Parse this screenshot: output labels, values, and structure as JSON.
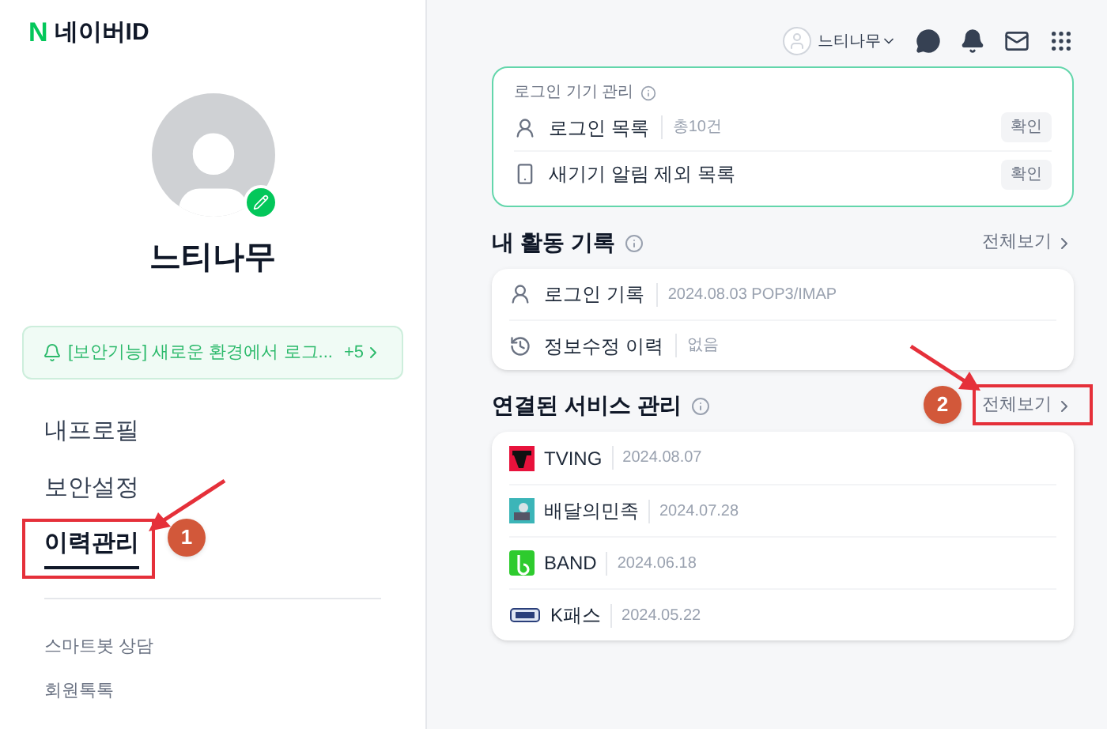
{
  "brand": {
    "mark": "N",
    "name": "네이버ID"
  },
  "profile": {
    "name": "느티나무",
    "editable": true
  },
  "notice": {
    "text": "[보안기능] 새로운 환경에서 로그...",
    "count": "+5"
  },
  "nav": [
    {
      "label": "내프로필",
      "selected": false
    },
    {
      "label": "보안설정",
      "selected": false
    },
    {
      "label": "이력관리",
      "selected": true
    }
  ],
  "footer_links": [
    "스마트봇 상담",
    "회원톡톡"
  ],
  "header": {
    "user": "느티나무"
  },
  "devices": {
    "title": "로그인 기기 관리",
    "rows": [
      {
        "kind": "person",
        "label": "로그인 목록",
        "detail": "총10건",
        "action": "확인"
      },
      {
        "kind": "phone",
        "label": "새기기 알림 제외 목록",
        "action": "확인"
      }
    ]
  },
  "activity": {
    "title": "내 활동 기록",
    "more": "전체보기",
    "rows": [
      {
        "kind": "person",
        "label": "로그인 기록",
        "detail": "2024.08.03 POP3/IMAP"
      },
      {
        "kind": "history",
        "label": "정보수정 이력",
        "detail": "없음"
      }
    ]
  },
  "services": {
    "title": "연결된 서비스 관리",
    "more": "전체보기",
    "rows": [
      {
        "kind": "tving",
        "name": "TVING",
        "date": "2024.08.07"
      },
      {
        "kind": "baemin",
        "name": "배달의민족",
        "date": "2024.07.28"
      },
      {
        "kind": "band",
        "name": "BAND",
        "date": "2024.06.18"
      },
      {
        "kind": "kpass",
        "name": "K패스",
        "date": "2024.05.22"
      }
    ]
  },
  "annotations": [
    {
      "number": "1"
    },
    {
      "number": "2"
    }
  ]
}
